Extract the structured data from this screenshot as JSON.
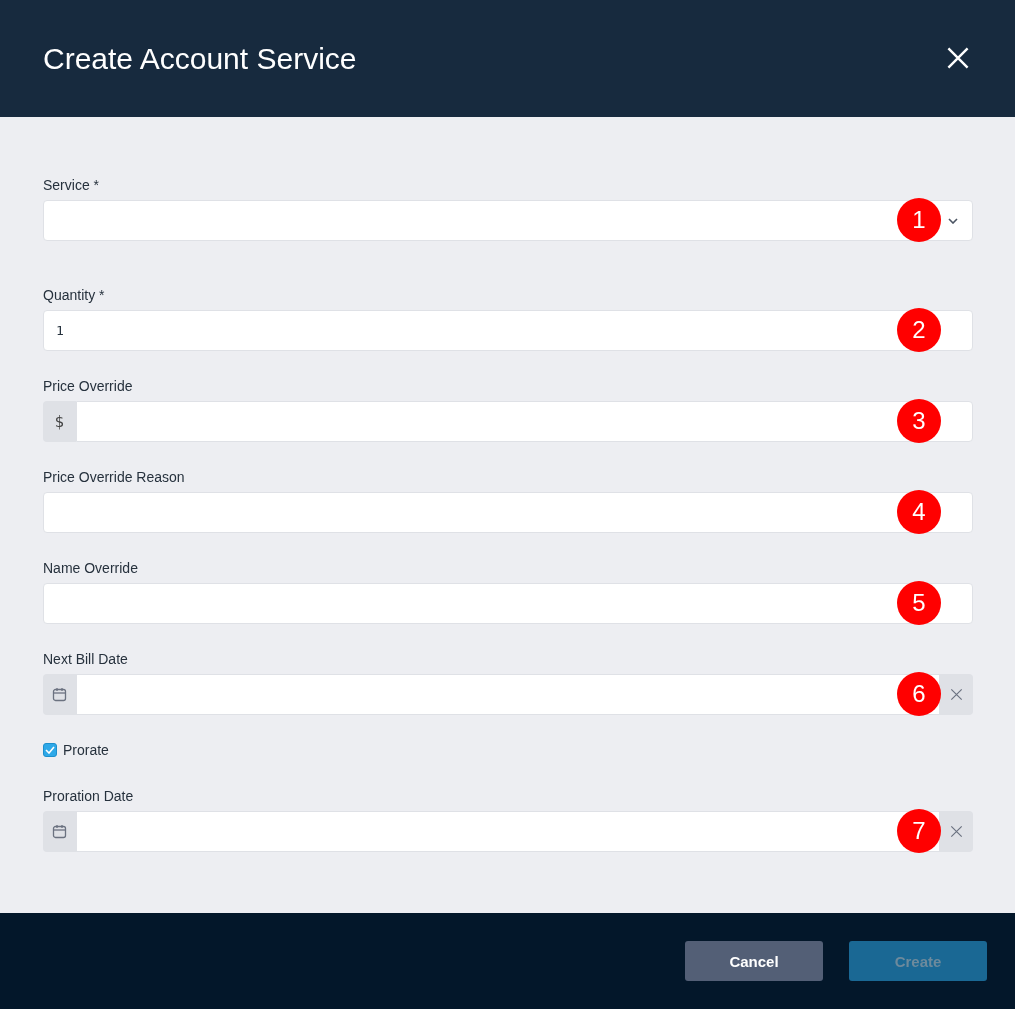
{
  "dialog": {
    "title": "Create Account Service"
  },
  "fields": [
    {
      "kind": "select",
      "label": "Service *",
      "marker": "1"
    },
    {
      "kind": "text",
      "label": "Quantity *",
      "value": "1",
      "marker": "2"
    },
    {
      "kind": "currency",
      "label": "Price Override",
      "prefix": "$",
      "marker": "3"
    },
    {
      "kind": "text",
      "label": "Price Override Reason",
      "marker": "4"
    },
    {
      "kind": "text",
      "label": "Name Override",
      "marker": "5"
    },
    {
      "kind": "date",
      "label": "Next Bill Date",
      "marker": "6"
    },
    {
      "kind": "checkbox",
      "label": "Prorate",
      "checked": true
    },
    {
      "kind": "date",
      "label": "Proration Date",
      "marker": "7"
    }
  ],
  "buttons": [
    {
      "label": "Cancel",
      "kind": "secondary",
      "disabled": false
    },
    {
      "label": "Create",
      "kind": "primary",
      "disabled": true
    }
  ]
}
